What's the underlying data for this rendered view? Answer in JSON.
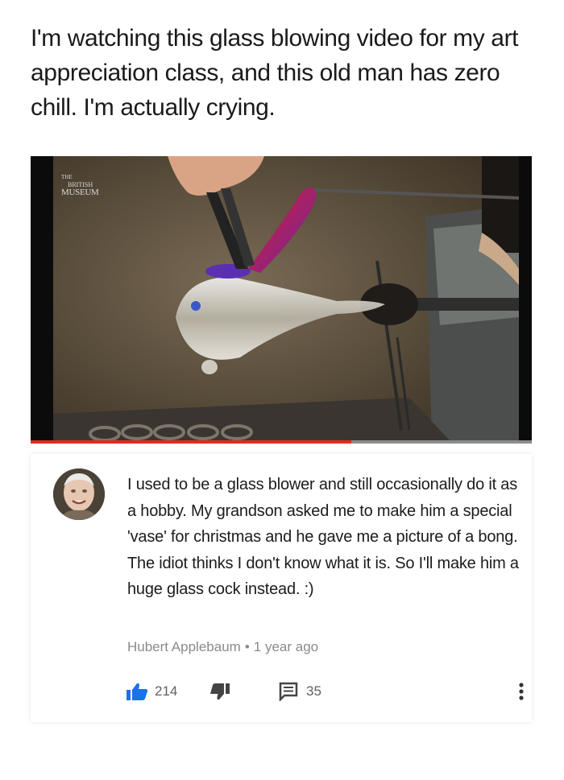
{
  "caption": "I'm watching this glass blowing video for my art appreciation class, and this old man has zero chill. I'm actually crying.",
  "video": {
    "watermark": {
      "line1": "THE",
      "line2": "BRITISH",
      "line3": "MUSEUM"
    },
    "progress_fraction": 0.64,
    "colors": {
      "progress": "#e22b1e",
      "track": "#8c8c8c"
    }
  },
  "comment": {
    "text": "I used to be a glass blower and still occasionally do it as a hobby.  My grandson asked me to make him a special 'vase' for christmas and he gave me a picture of a bong. The idiot thinks I don't know what it is. So I'll make him a huge glass cock instead. :)",
    "author": "Hubert Applebaum",
    "separator": "•",
    "time": "1 year ago",
    "likes": "214",
    "replies": "35",
    "icons": {
      "like": "thumbs-up-icon",
      "dislike": "thumbs-down-icon",
      "reply": "comment-icon",
      "more": "more-vertical-icon"
    },
    "like_color": "#1a73e8"
  }
}
